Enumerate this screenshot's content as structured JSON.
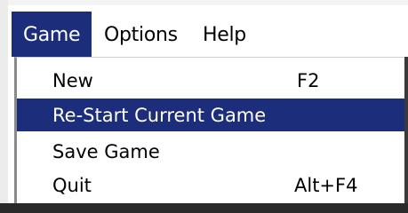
{
  "menubar": {
    "items": [
      {
        "label": "Game"
      },
      {
        "label": "Options"
      },
      {
        "label": "Help"
      }
    ]
  },
  "game_menu": {
    "items": [
      {
        "label": "New",
        "shortcut": "F2"
      },
      {
        "label": "Re-Start Current Game",
        "shortcut": ""
      },
      {
        "label": "Save Game",
        "shortcut": ""
      },
      {
        "label": "Quit",
        "shortcut": "Alt+F4"
      }
    ],
    "highlighted_item": "Re-Start Current Game"
  },
  "colors": {
    "highlight": "#1c2d7c",
    "highlight_text": "#ffffff",
    "menu_background": "#ffffff"
  }
}
